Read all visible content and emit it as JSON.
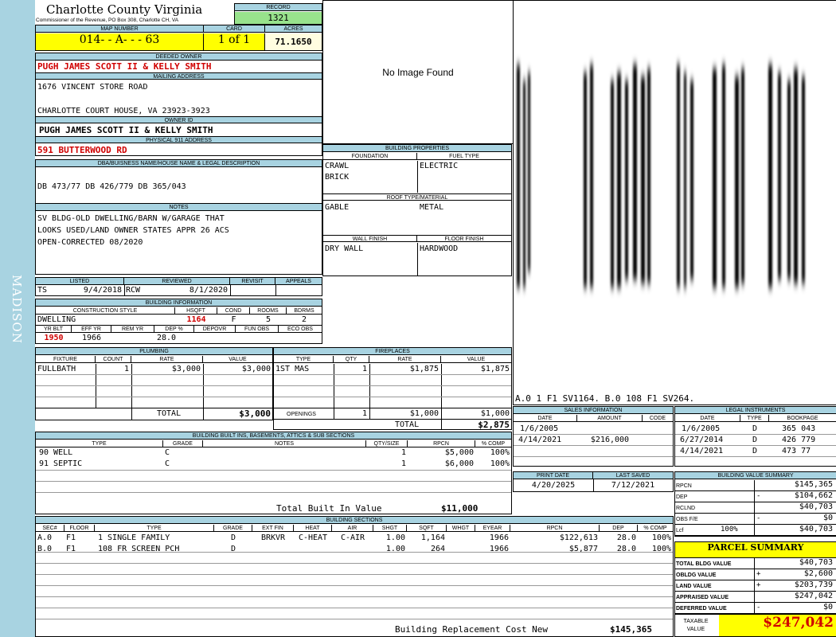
{
  "county": "Charlotte County Virginia",
  "commissioner": "Commissioner of the Revenue, PO Box 308, Charlotte CH, VA",
  "side_label": "MADISON",
  "record": {
    "label": "RECORD",
    "value": "1321"
  },
  "map": {
    "label": "MAP NUMBER",
    "value": "014- - A- - - 63"
  },
  "card": {
    "label": "CARD",
    "value": "1 of 1"
  },
  "acres": {
    "label": "ACRES",
    "value": "71.1650"
  },
  "deeded": {
    "label": "DEEDED OWNER",
    "value": "PUGH JAMES SCOTT II & KELLY SMITH"
  },
  "mailing": {
    "label": "MAILING ADDRESS",
    "line1": "1676 VINCENT STORE ROAD",
    "line2": "CHARLOTTE COURT HOUSE, VA 23923-3923"
  },
  "owner_id": {
    "label": "OWNER ID",
    "value": "PUGH JAMES SCOTT II & KELLY SMITH"
  },
  "physical": {
    "label": "PHYSICAL 911 ADDRESS",
    "value": "591 BUTTERWOOD RD"
  },
  "dba": {
    "label": "DBA/BUISNESS NAME/HOUSE NAME & LEGAL DESCRIPTION",
    "value": "DB 473/77 DB 426/779 DB 365/043"
  },
  "notes": {
    "label": "NOTES",
    "lines": [
      "SV BLDG-OLD DWELLING/BARN W/GARAGE THAT",
      "LOOKS USED/LAND OWNER STATES APPR 26 ACS",
      "OPEN-CORRECTED 08/2020"
    ]
  },
  "listed": {
    "label": "LISTED",
    "by": "TS",
    "date": "9/4/2018"
  },
  "reviewed": {
    "label": "REVIEWED",
    "by": "RCW",
    "date": "8/1/2020"
  },
  "revisit": {
    "label": "REVISIT"
  },
  "appeals": {
    "label": "APPEALS"
  },
  "bldg_info": {
    "label": "BUILDING INFORMATION",
    "h_style": "CONSTRUCTION STYLE",
    "h_sqft": "HSQFT",
    "h_cond": "COND",
    "h_rooms": "ROOMS",
    "h_bdrms": "BDRMS",
    "style": "DWELLING",
    "sqft": "1164",
    "cond": "F",
    "rooms": "5",
    "bdrms": "2",
    "h_yrblt": "YR BLT",
    "h_effyr": "EFF YR",
    "h_remyr": "REM YR",
    "h_dep": "DEP %",
    "h_depovr": "DEPOVR",
    "h_funobs": "FUN OBS",
    "h_ecoobs": "ECO OBS",
    "yrblt": "1950",
    "effyr": "1966",
    "dep": "28.0"
  },
  "image": {
    "no_image": "No Image Found"
  },
  "sketch": {
    "labels": "A.0  1   F1  SV1164.  B.0  108  F1  SV264."
  },
  "bprops": {
    "label": "BUILDING PROPERTIES",
    "h_foundation": "FOUNDATION",
    "h_fuel": "FUEL TYPE",
    "foundation1": "CRAWL",
    "foundation2": "BRICK",
    "fuel": "ELECTRIC",
    "h_roof": "ROOF TYPE/MATERIAL",
    "roof_type": "GABLE",
    "roof_mat": "METAL",
    "h_wall": "WALL FINISH",
    "h_floor": "FLOOR FINISH",
    "wall": "DRY WALL",
    "floor": "HARDWOOD"
  },
  "plumbing": {
    "label": "PLUMBING",
    "h_fixture": "FIXTURE",
    "h_count": "COUNT",
    "h_rate": "RATE",
    "h_value": "VALUE",
    "rows": [
      {
        "fixture": "FULLBATH",
        "count": "1",
        "rate": "$3,000",
        "value": "$3,000"
      }
    ],
    "total_label": "TOTAL",
    "total": "$3,000"
  },
  "fireplaces": {
    "label": "FIREPLACES",
    "h_type": "TYPE",
    "h_qty": "QTY",
    "h_rate": "RATE",
    "h_value": "VALUE",
    "rows": [
      {
        "type": "1ST MAS",
        "qty": "1",
        "rate": "$1,875",
        "value": "$1,875"
      }
    ],
    "openings_label": "OPENINGS",
    "openings_qty": "1",
    "openings_rate": "$1,000",
    "openings_value": "$1,000",
    "total_label": "TOTAL",
    "total": "$2,875"
  },
  "sales": {
    "label": "SALES INFORMATION",
    "h_date": "DATE",
    "h_amount": "AMOUNT",
    "h_code": "CODE",
    "rows": [
      {
        "date": "1/6/2005",
        "amount": "",
        "code": ""
      },
      {
        "date": "4/14/2021",
        "amount": "$216,000",
        "code": ""
      }
    ]
  },
  "legal": {
    "label": "LEGAL INSTRUMENTS",
    "h_date": "DATE",
    "h_type": "TYPE",
    "h_bookpage": "BOOKPAGE",
    "rows": [
      {
        "date": "1/6/2005",
        "type": "D",
        "bookpage": "365 043"
      },
      {
        "date": "6/27/2014",
        "type": "D",
        "bookpage": "426 779"
      },
      {
        "date": "4/14/2021",
        "type": "D",
        "bookpage": "473 77"
      }
    ]
  },
  "builtins": {
    "label": "BUILDING BUILT INS, BASEMENTS, ATTICS & SUB SECTIONS",
    "h_type": "TYPE",
    "h_grade": "GRADE",
    "h_notes": "NOTES",
    "h_qty": "QTY/SIZE",
    "h_rpcn": "RPCN",
    "h_comp": "% COMP",
    "rows": [
      {
        "type": "90 WELL",
        "grade": "C",
        "notes": "",
        "qty": "1",
        "rpcn": "$5,000",
        "comp": "100%"
      },
      {
        "type": "91 SEPTIC",
        "grade": "C",
        "notes": "",
        "qty": "1",
        "rpcn": "$6,000",
        "comp": "100%"
      }
    ],
    "total_label": "Total Built In Value",
    "total": "$11,000"
  },
  "print": {
    "label": "PRINT DATE",
    "value": "4/20/2025"
  },
  "saved": {
    "label": "LAST SAVED",
    "value": "7/12/2021"
  },
  "bvs": {
    "label": "BUILDING VALUE SUMMARY",
    "rows": [
      {
        "label": "RPCN",
        "sign": "",
        "pct": "",
        "value": "$145,365"
      },
      {
        "label": "DEP",
        "sign": "-",
        "pct": "",
        "value": "$104,662"
      },
      {
        "label": "RCLND",
        "sign": "",
        "pct": "",
        "value": "$40,703"
      },
      {
        "label": "OBS F/E",
        "sign": "-",
        "pct": "",
        "value": "$0"
      },
      {
        "label": "Lcf",
        "sign": "",
        "pct": "100%",
        "value": "$40,703"
      }
    ]
  },
  "sections": {
    "label": "BUILDING SECTIONS",
    "h": [
      "SEC#",
      "FLOOR",
      "TYPE",
      "GRADE",
      "EXT FIN",
      "HEAT",
      "AIR",
      "SHGT",
      "SQFT",
      "WHGT",
      "EYEAR",
      "RPCN",
      "DEP",
      "% COMP"
    ],
    "rows": [
      [
        "A.0",
        "F1",
        "1 SINGLE FAMILY",
        "D",
        "BRKVR",
        "C-HEAT",
        "C-AIR",
        "1.00",
        "1,164",
        "",
        "1966",
        "$122,613",
        "28.0",
        "100%"
      ],
      [
        "B.0",
        "F1",
        "108 FR SCREEN PCH",
        "D",
        "",
        "",
        "",
        "1.00",
        "264",
        "",
        "1966",
        "$5,877",
        "28.0",
        "100%"
      ]
    ],
    "total_label": "Building Replacement Cost New",
    "total": "$145,365"
  },
  "parcel": {
    "label": "PARCEL SUMMARY",
    "rows": [
      {
        "label": "TOTAL BLDG VALUE",
        "sign": "",
        "value": "$40,703"
      },
      {
        "label": "OBLDG VALUE",
        "sign": "+",
        "value": "$2,600"
      },
      {
        "label": "LAND VALUE",
        "sign": "+",
        "value": "$203,739"
      },
      {
        "label": "APPRAISED VALUE",
        "sign": "",
        "value": "$247,042"
      },
      {
        "label": "DEFERRED VALUE",
        "sign": "-",
        "value": "$0"
      }
    ],
    "taxable_label1": "TAXABLE",
    "taxable_label2": "VALUE",
    "taxable": "$247,042"
  },
  "colors": {
    "header_blue": "#a8d3e1",
    "highlight_yellow": "#ffff00",
    "record_green": "#98e28c",
    "value_red": "#d00000"
  }
}
